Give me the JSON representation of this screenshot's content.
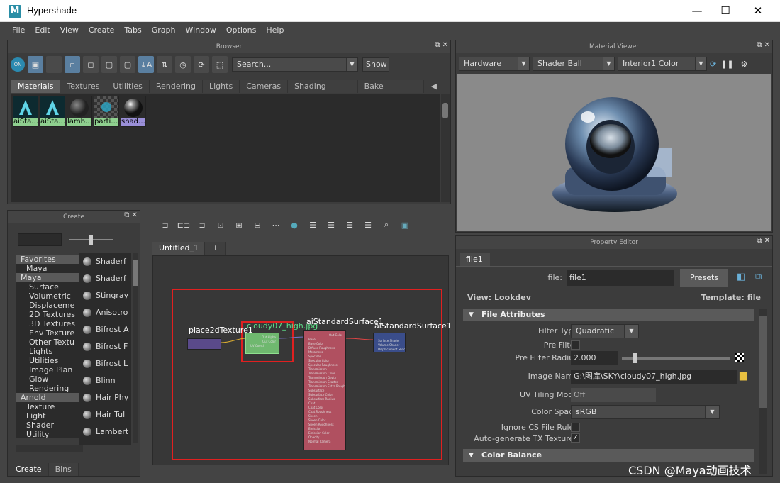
{
  "window": {
    "title": "Hypershade",
    "min": "—",
    "max": "☐",
    "close": "✕"
  },
  "menu": [
    "File",
    "Edit",
    "View",
    "Create",
    "Tabs",
    "Graph",
    "Window",
    "Options",
    "Help"
  ],
  "browser": {
    "title": "Browser",
    "search_placeholder": "Search...",
    "show_label": "Show",
    "tabs": [
      "Materials",
      "Textures",
      "Utilities",
      "Rendering",
      "Lights",
      "Cameras",
      "Shading Groups",
      "Bake Sets"
    ],
    "swatches": [
      "aiSta…",
      "aiSta…",
      "lamb…",
      "parti…",
      "shad…"
    ]
  },
  "material_viewer": {
    "title": "Material Viewer",
    "renderer": "Hardware",
    "shape": "Shader Ball",
    "env": "Interior1 Color"
  },
  "create_panel": {
    "title": "Create",
    "tree": [
      {
        "label": "Favorites",
        "type": "hdr"
      },
      {
        "label": "Maya",
        "type": "sub"
      },
      {
        "label": "Maya",
        "type": "hdr"
      },
      {
        "label": "Surface",
        "type": "item"
      },
      {
        "label": "Volumetric",
        "type": "item"
      },
      {
        "label": "Displaceme",
        "type": "item"
      },
      {
        "label": "2D Textures",
        "type": "item"
      },
      {
        "label": "3D Textures",
        "type": "item"
      },
      {
        "label": "Env Texture",
        "type": "item"
      },
      {
        "label": "Other Textu",
        "type": "item"
      },
      {
        "label": "Lights",
        "type": "item"
      },
      {
        "label": "Utilities",
        "type": "item"
      },
      {
        "label": "Image Plan",
        "type": "item"
      },
      {
        "label": "Glow",
        "type": "item"
      },
      {
        "label": "Rendering",
        "type": "item"
      },
      {
        "label": "Arnold",
        "type": "hdr"
      },
      {
        "label": "Texture",
        "type": "sub"
      },
      {
        "label": "Light",
        "type": "sub"
      },
      {
        "label": "Shader",
        "type": "sub"
      },
      {
        "label": "Utility",
        "type": "sub"
      }
    ],
    "nodes": [
      "Shaderf",
      "Shaderf",
      "Stingray",
      "Anisotro",
      "Bifrost A",
      "Bifrost F",
      "Bifrost L",
      "Blinn",
      "Hair Phy",
      "Hair Tul",
      "Lambert"
    ],
    "bottom_tabs": [
      "Create",
      "Bins"
    ]
  },
  "graph": {
    "tab": "Untitled_1",
    "add_tab": "+",
    "nodes": {
      "place2d": "place2dTexture1",
      "file": "cloudy07_high.jpg",
      "ai1": "aiStandardSurface1",
      "ai2": "aiStandardSurface1"
    },
    "place2d_out": "Out UV",
    "file_attrs": [
      "Out Alpha",
      "Out Color",
      "UV Coord"
    ],
    "ai_attrs": [
      "Out Color",
      "Base",
      "Base Color",
      "Diffuse Roughness",
      "Metalness",
      "Specular",
      "Specular Color",
      "Specular Roughness",
      "Transmission",
      "Transmission Color",
      "Transmission Depth",
      "Transmission Scatter",
      "Transmission Extra Roughness",
      "Subsurface",
      "Subsurface Color",
      "Subsurface Radius",
      "Coat",
      "Coat Color",
      "Coat Roughness",
      "Sheen",
      "Sheen Color",
      "Sheen Roughness",
      "Emission",
      "Emission Color",
      "Opacity",
      "Normal Camera"
    ],
    "sg_attrs": [
      "Surface Shader",
      "Volume Shader",
      "Displacement Shader"
    ]
  },
  "property_editor": {
    "title": "Property Editor",
    "tab": "file1",
    "file_label": "file:",
    "file_value": "file1",
    "presets": "Presets",
    "view": "View: Lookdev",
    "template": "Template: file",
    "sections": {
      "file_attributes": "File Attributes",
      "color_balance": "Color Balance"
    },
    "filter_type": {
      "label": "Filter Type",
      "value": "Quadratic"
    },
    "pre_filter": {
      "label": "Pre Filter"
    },
    "pre_filter_radius": {
      "label": "Pre Filter Radius",
      "value": "2.000"
    },
    "image_name": {
      "label": "Image Name",
      "value": "G:\\图库\\SKY\\cloudy07_high.jpg"
    },
    "uv_tiling": {
      "label": "UV Tiling Mode",
      "value": "Off"
    },
    "color_space": {
      "label": "Color Space",
      "value": "sRGB"
    },
    "ignore_cs": {
      "label": "Ignore CS File Rules"
    },
    "auto_tx": {
      "label": "Auto-generate TX Textures"
    }
  },
  "watermark": "CSDN @Maya动画技术",
  "colors": {
    "accent": "#5a7fa0",
    "highlight": "#e02020",
    "file_node": "#6fb86f",
    "ai_node": "#b05060",
    "sg_node": "#3a4d8a",
    "place_node": "#5a4a8a"
  }
}
